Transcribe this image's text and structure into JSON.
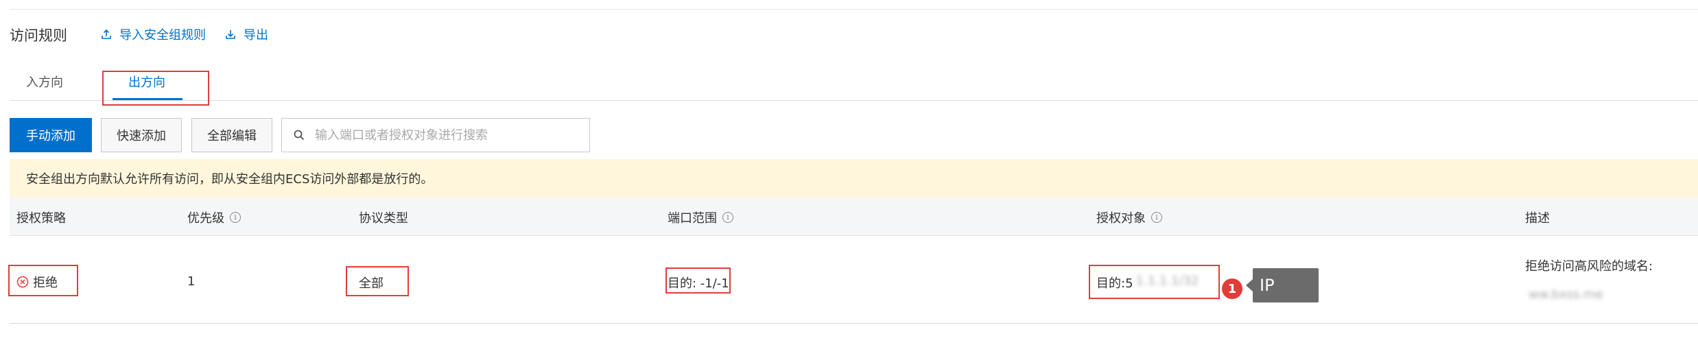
{
  "header": {
    "title": "访问规则",
    "import_label": "导入安全组规则",
    "export_label": "导出"
  },
  "tabs": [
    {
      "label": "入方向",
      "active": false
    },
    {
      "label": "出方向",
      "active": true
    }
  ],
  "toolbar": {
    "manual_add": "手动添加",
    "quick_add": "快速添加",
    "edit_all": "全部编辑",
    "search_placeholder": "输入端口或者授权对象进行搜索"
  },
  "notice": "安全组出方向默认允许所有访问，即从安全组内ECS访问外部都是放行的。",
  "table": {
    "headers": {
      "policy": "授权策略",
      "priority": "优先级",
      "protocol": "协议类型",
      "port_range": "端口范围",
      "target": "授权对象",
      "description": "描述"
    },
    "rows": [
      {
        "policy": "拒绝",
        "priority": "1",
        "protocol": "全部",
        "port_range": "目的: -1/-1",
        "target_prefix": "目的:5",
        "target_hidden": "1.1.1.1/32",
        "description": "拒绝访问高风险的域名:",
        "description_hidden": "ww.bxss.me"
      }
    ]
  },
  "annotation": {
    "badge": "1",
    "tooltip": "IP"
  },
  "colors": {
    "accent": "#0070cc",
    "highlight_box": "#e23c39",
    "notice_bg": "#fff6dc",
    "header_bg": "#f5f6f7"
  }
}
